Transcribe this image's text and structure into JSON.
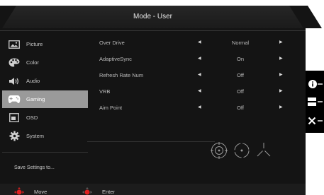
{
  "window": {
    "title": "Mode - User"
  },
  "sidebar": {
    "items": [
      {
        "label": "Picture",
        "icon": "picture-icon",
        "active": false
      },
      {
        "label": "Color",
        "icon": "color-palette-icon",
        "active": false
      },
      {
        "label": "Audio",
        "icon": "speaker-icon",
        "active": false
      },
      {
        "label": "Gaming",
        "icon": "gamepad-icon",
        "active": true
      },
      {
        "label": "OSD",
        "icon": "osd-icon",
        "active": false
      },
      {
        "label": "System",
        "icon": "gear-icon",
        "active": false
      }
    ],
    "save_label": "Save Settings to..."
  },
  "settings": [
    {
      "name": "Over Drive",
      "value": "Normal"
    },
    {
      "name": "AdaptiveSync",
      "value": "On"
    },
    {
      "name": "Refresh Rate Num",
      "value": "Off"
    },
    {
      "name": "VRB",
      "value": "Off"
    },
    {
      "name": "Aim Point",
      "value": "Off"
    }
  ],
  "aim_point_icons": [
    "aim-point-circle-icon",
    "aim-point-dotted-icon",
    "aim-point-cross-icon"
  ],
  "footer": {
    "move_label": "Move",
    "enter_label": "Enter"
  },
  "side_keys": [
    "info-icon",
    "menu-icon",
    "close-icon"
  ],
  "colors": {
    "accent": "#e02020",
    "active_bg": "#9a9a9a",
    "osd_bg": "#141414"
  }
}
